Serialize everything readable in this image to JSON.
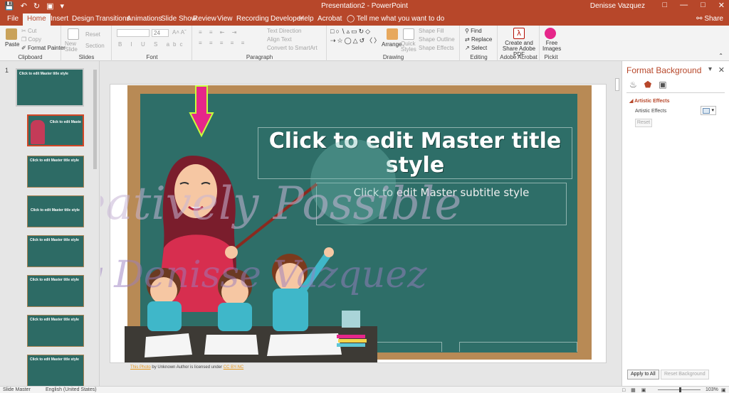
{
  "app": {
    "document_title": "Presentation2  -  PowerPoint",
    "user": "Denisse Vazquez",
    "share": "Share",
    "tell_me": "Tell me what you want to do"
  },
  "tabs": [
    "File",
    "Home",
    "Insert",
    "Design",
    "Transitions",
    "Animations",
    "Slide Show",
    "Review",
    "View",
    "Recording",
    "Developer",
    "Help",
    "Acrobat"
  ],
  "active_tab": "Home",
  "ribbon": {
    "clipboard": {
      "label": "Clipboard",
      "paste": "Paste",
      "cut": "Cut",
      "copy": "Copy",
      "format_painter": "Format Painter"
    },
    "slides": {
      "label": "Slides",
      "new_slide": "New Slide",
      "reset": "Reset",
      "section": "Section"
    },
    "font": {
      "label": "Font",
      "size": "24"
    },
    "paragraph": {
      "label": "Paragraph",
      "text_direction": "Text Direction",
      "align_text": "Align Text",
      "convert_smartart": "Convert to SmartArt"
    },
    "drawing": {
      "label": "Drawing",
      "arrange": "Arrange",
      "quick_styles": "Quick Styles",
      "shape_fill": "Shape Fill",
      "shape_outline": "Shape Outline",
      "shape_effects": "Shape Effects"
    },
    "editing": {
      "label": "Editing",
      "find": "Find",
      "replace": "Replace",
      "select": "Select"
    },
    "acrobat": {
      "label": "Adobe Acrobat",
      "create_share": "Create and Share Adobe PDF"
    },
    "pickit": {
      "label": "Pickit",
      "free_images": "Free Images"
    }
  },
  "thumbnails": {
    "master_number": "1",
    "master_title": "Click to edit Master title style",
    "layouts": [
      "Click to edit Master title style",
      "Click to edit Master title style",
      "Click to edit Master title style",
      "Click to edit Master title style",
      "Click to edit Master title style",
      "Click to edit Master title style",
      "Click to edit Master title style"
    ]
  },
  "slide": {
    "title": "Click to edit Master title style",
    "subtitle": "Click to edit Master subtitle style",
    "watermark_line1": "Creatively Possible",
    "watermark_line2": "by Denisse Vazquez"
  },
  "caption": {
    "link_photo": "This Photo",
    "middle": " by Unknown Author is licensed under ",
    "link_license": "CC BY-NC"
  },
  "format_pane": {
    "title": "Format Background",
    "section": "Artistic Effects",
    "artistic_label": "Artistic Effects",
    "reset": "Reset",
    "apply_all": "Apply to All",
    "reset_background": "Reset Background"
  },
  "status": {
    "view": "Slide Master",
    "language": "English (United States)",
    "zoom": "103%"
  },
  "colors": {
    "accent": "#b7472a",
    "board": "#2e6e68",
    "frame": "#b88a55",
    "arrow": "#e6268a"
  }
}
